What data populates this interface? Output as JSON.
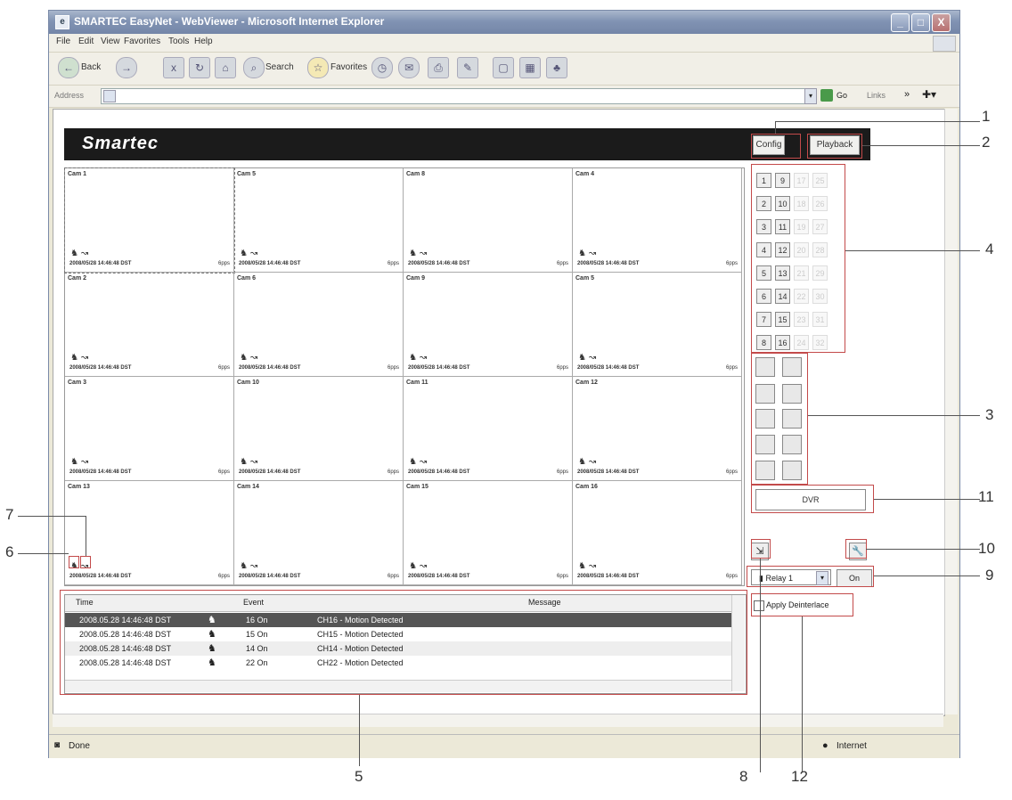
{
  "window": {
    "title": "SMARTEC EasyNet - WebViewer - Microsoft Internet Explorer",
    "minimize": "_",
    "maximize": "□",
    "close": "X"
  },
  "menu": [
    "File",
    "Edit",
    "View",
    "Favorites",
    "Tools",
    "Help"
  ],
  "toolbar": {
    "back": "Back",
    "search": "Search",
    "favorites": "Favorites"
  },
  "address": {
    "label": "Address",
    "go": "Go",
    "links": "Links"
  },
  "app": {
    "logo": "Smartec",
    "config": "Config",
    "playback": "Playback"
  },
  "cameras": [
    {
      "name": "Cam 1",
      "fps": "6pps"
    },
    {
      "name": "Cam 5",
      "fps": "6pps"
    },
    {
      "name": "Cam 8",
      "fps": "6pps"
    },
    {
      "name": "Cam 4",
      "fps": "6pps"
    },
    {
      "name": "Cam 2",
      "fps": "6pps"
    },
    {
      "name": "Cam 6",
      "fps": "6pps"
    },
    {
      "name": "Cam 9",
      "fps": "6pps"
    },
    {
      "name": "Cam 5",
      "fps": "6pps"
    },
    {
      "name": "Cam 3",
      "fps": "6pps"
    },
    {
      "name": "Cam 10",
      "fps": "6pps"
    },
    {
      "name": "Cam 11",
      "fps": "6pps"
    },
    {
      "name": "Cam 12",
      "fps": "6pps"
    },
    {
      "name": "Cam 13",
      "fps": "6pps"
    },
    {
      "name": "Cam 14",
      "fps": "6pps"
    },
    {
      "name": "Cam 15",
      "fps": "6pps"
    },
    {
      "name": "Cam 16",
      "fps": "6pps"
    }
  ],
  "timestamp": "2008/05/28 14:46:48 DST",
  "channels": [
    "1",
    "9",
    "17",
    "25",
    "2",
    "10",
    "18",
    "26",
    "3",
    "11",
    "19",
    "27",
    "4",
    "12",
    "20",
    "28",
    "5",
    "13",
    "21",
    "29",
    "6",
    "14",
    "22",
    "30",
    "7",
    "15",
    "23",
    "31",
    "8",
    "16",
    "24",
    "32"
  ],
  "dvr": "DVR",
  "relay": {
    "label": "Relay 1",
    "on": "On"
  },
  "deinterlace": "Apply Deinterlace",
  "events": {
    "headers": {
      "time": "Time",
      "event": "Event",
      "message": "Message"
    },
    "rows": [
      {
        "time": "2008.05.28 14:46:48 DST",
        "event": "16 On",
        "message": "CH16 - Motion Detected"
      },
      {
        "time": "2008.05.28 14:46:48 DST",
        "event": "15 On",
        "message": "CH15 - Motion Detected"
      },
      {
        "time": "2008.05.28 14:46:48 DST",
        "event": "14 On",
        "message": "CH14 - Motion Detected"
      },
      {
        "time": "2008.05.28 14:46:48 DST",
        "event": "22 On",
        "message": "CH22 - Motion Detected"
      }
    ]
  },
  "status": {
    "done": "Done",
    "zone": "Internet"
  },
  "callouts": [
    "1",
    "2",
    "3",
    "4",
    "5",
    "6",
    "7",
    "8",
    "9",
    "10",
    "11",
    "12"
  ],
  "colors": {
    "callout": "#c34a4a",
    "header_bg": "#1b1b1b",
    "selected_row": "#555555"
  }
}
